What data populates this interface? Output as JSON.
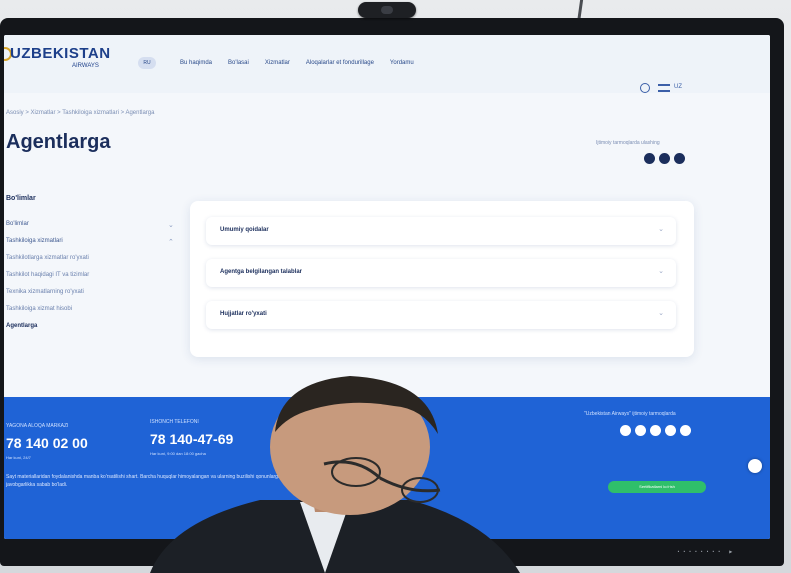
{
  "site": {
    "logo_title": "UZBEKISTAN",
    "logo_sub": "AIRWAYS",
    "lang_pill": "RU",
    "nav": [
      "Bu haqimda",
      "Bo'lasai",
      "Xizmatlar",
      "Aloqalarlar et fondurillage",
      "Yordamu"
    ],
    "lang_menu": "UZ"
  },
  "breadcrumb": "Asosiy > Xizmatlar > Tashkiloiga xizmatlari > Agentlarga",
  "page_title": "Agentlarga",
  "share_label": "Ijtimoiy tarmoqlarda ulashing",
  "sidebar": {
    "title": "Bo'limlar",
    "items": [
      {
        "label": "Bo'limlar",
        "chev": "⌄"
      },
      {
        "label": "Tashkiloiga xizmatlari",
        "chev": "⌃"
      },
      {
        "label": "Tashkilotlarga xizmatlar ro'yxati",
        "chev": ""
      },
      {
        "label": "Tashkilot haqidagi IT va tizimlar",
        "chev": ""
      },
      {
        "label": "Texnika xizmatlarning ro'yxati",
        "chev": ""
      },
      {
        "label": "Tashkiloiga xizmat hisobi",
        "chev": ""
      },
      {
        "label": "Agentlarga",
        "chev": ""
      }
    ]
  },
  "accordion": [
    {
      "label": "Umumiy qoidalar",
      "chev": "⌄"
    },
    {
      "label": "Agentga belgilangan talablar",
      "chev": "⌄"
    },
    {
      "label": "Hujjatlar ro'yxati",
      "chev": "⌄"
    }
  ],
  "footer": {
    "label1": "YAGONA ALOQA MARKAZI",
    "phone1": "78 140 02 00",
    "sub1": "Har kuni, 24/7",
    "label2": "ISHONCH TELEFONI",
    "phone2": "78 140-47-69",
    "sub2": "Har kuni, 9:00 dan 18:00 gacha",
    "social_label": "\"Uzbekistan Airways\" ijtimoiy tarmoqlarda",
    "text": "Sayt materiallaridan foydalanishda manba ko'rsatilishi shart. Barcha huquqlar himoyalangan va ularning buzilishi qonunlarga muvofiq javobgarlikka sabab bo'ladi.",
    "button": "Sertifikatlarni ko'rish"
  },
  "bezel_brand": "········ ▸"
}
